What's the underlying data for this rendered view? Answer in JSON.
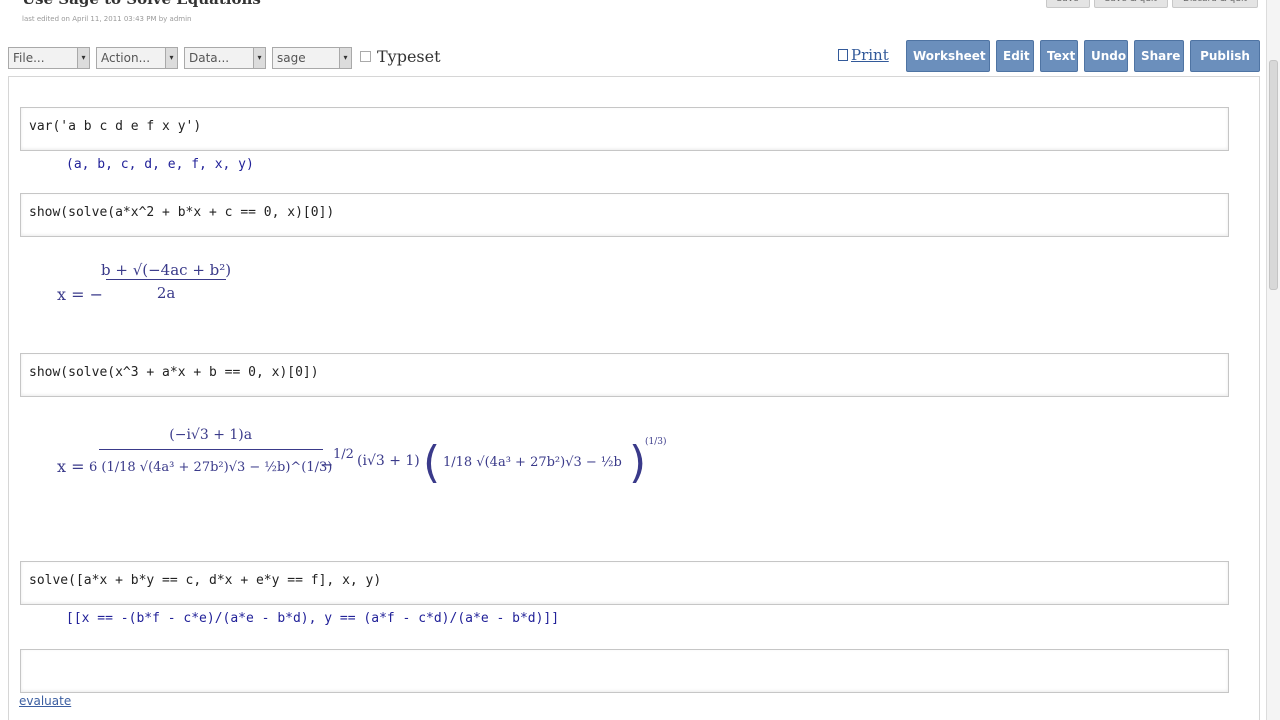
{
  "header": {
    "title": "Use Sage to Solve Equations",
    "last_edited": "last edited on April 11, 2011 03:43 PM by admin",
    "top_buttons": [
      "Save",
      "Save & quit",
      "Discard & quit"
    ]
  },
  "toolbar": {
    "file": "File...",
    "action": "Action...",
    "data": "Data...",
    "system": "sage",
    "typeset": "Typeset",
    "print": "Print",
    "buttons": [
      "Worksheet",
      "Edit",
      "Text",
      "Undo",
      "Share",
      "Publish"
    ]
  },
  "cells": [
    {
      "input": "var('a b c d e f x y')",
      "output": "(a, b, c, d, e, f, x, y)"
    },
    {
      "input": "show(solve(a*x^2 + b*x + c == 0, x)[0])"
    },
    {
      "input": "show(solve(x^3 + a*x + b == 0, x)[0])"
    },
    {
      "input": "solve([a*x + b*y == c, d*x + e*y == f], x, y)",
      "output": "[[x == -(b*f - c*e)/(a*e - b*d), y == (a*f - c*d)/(a*e - b*d)]]"
    },
    {
      "input": ""
    }
  ],
  "math": {
    "quadratic": {
      "lhs": "x = −",
      "num": "b + √(−4ac + b²)",
      "den": "2a"
    },
    "cubic": {
      "lhs": "x =",
      "num": "(−i√3 + 1)a",
      "den": "6 (1/18 √(4a³ + 27b²)√3 − ½b)^(1/3)",
      "minus": "−",
      "half": "1/2",
      "mid": "(i√3 + 1)",
      "inner": "1/18 √(4a³ + 27b²)√3 − ½b",
      "exp": "(1/3)"
    }
  },
  "evaluate": "evaluate"
}
